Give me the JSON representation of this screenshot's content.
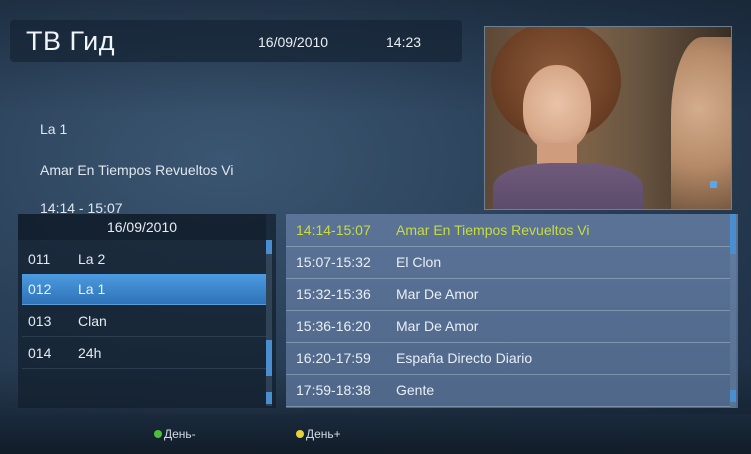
{
  "header": {
    "title": "ТВ Гид",
    "date": "16/09/2010",
    "time": "14:23"
  },
  "current_program": {
    "channel": "La 1",
    "title": "Amar En Tiempos Revueltos Vi",
    "time_range": "14:14 - 15:07"
  },
  "channel_list": {
    "date": "16/09/2010",
    "items": [
      {
        "number": "011",
        "name": "La 2",
        "selected": false
      },
      {
        "number": "012",
        "name": "La 1",
        "selected": true
      },
      {
        "number": "013",
        "name": "Clan",
        "selected": false
      },
      {
        "number": "014",
        "name": "24h",
        "selected": false
      }
    ]
  },
  "schedule": {
    "items": [
      {
        "time": "14:14-15:07",
        "title": "Amar En Tiempos Revueltos Vi",
        "current": true
      },
      {
        "time": "15:07-15:32",
        "title": "El Clon",
        "current": false
      },
      {
        "time": "15:32-15:36",
        "title": "Mar De Amor",
        "current": false
      },
      {
        "time": "15:36-16:20",
        "title": "Mar De Amor",
        "current": false
      },
      {
        "time": "16:20-17:59",
        "title": "España Directo Diario",
        "current": false
      },
      {
        "time": "17:59-18:38",
        "title": "Gente",
        "current": false
      }
    ]
  },
  "footer": {
    "day_prev_label": "День-",
    "day_prev_color": "#4bbf3a",
    "day_next_label": "День+",
    "day_next_color": "#e8d23a"
  },
  "colors": {
    "accent_blue": "#3d86cf",
    "current_program": "#c8dd3c"
  },
  "icons": {
    "prev_day": "green-dot-icon",
    "next_day": "yellow-dot-icon"
  }
}
